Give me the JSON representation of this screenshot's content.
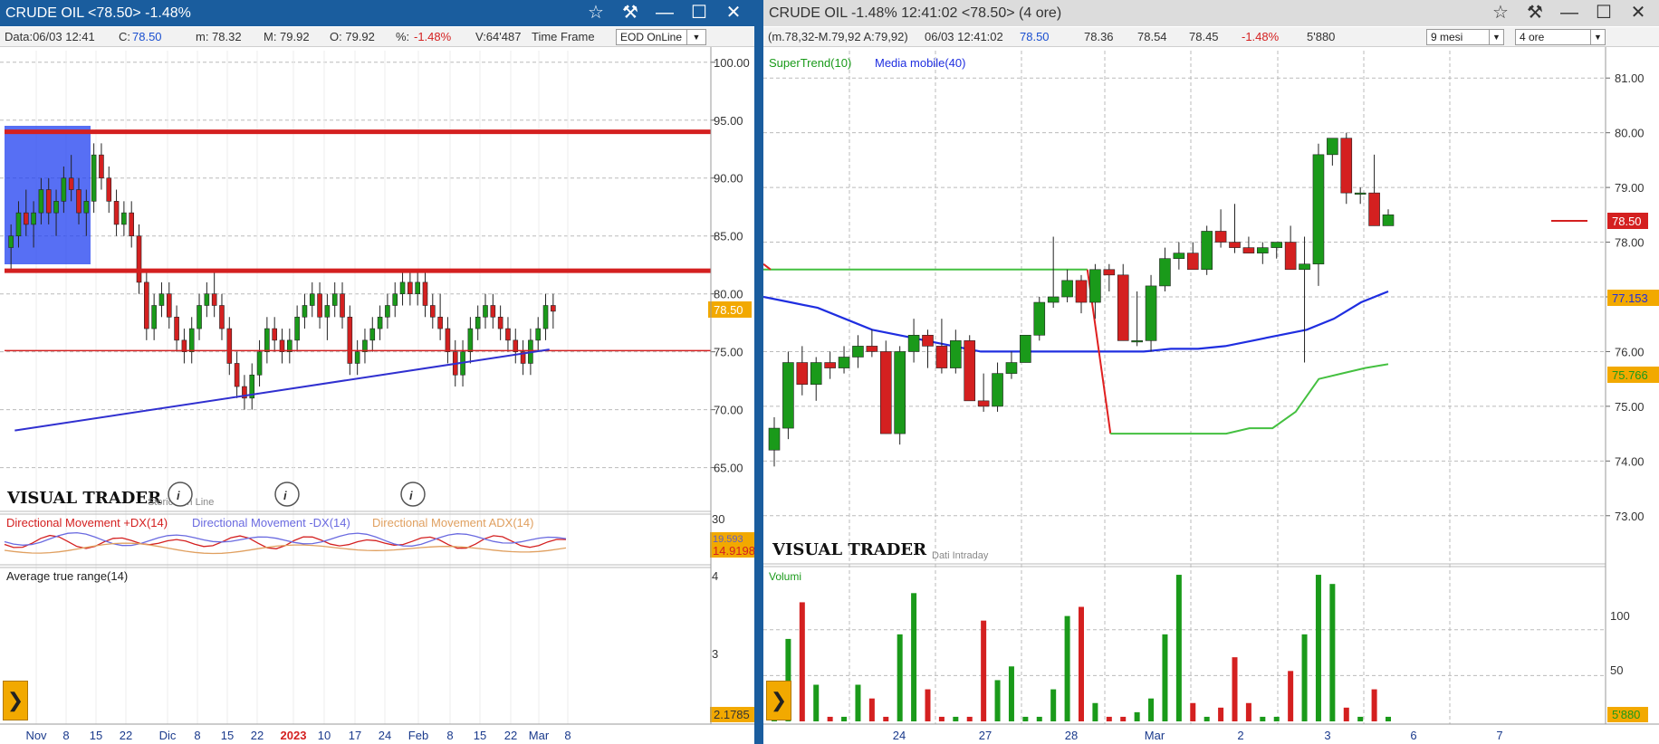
{
  "left": {
    "title": "CRUDE OIL <78.50> -1.48%",
    "info": {
      "data": "Data:06/03 12:41",
      "close_label": "C:",
      "close": "78.50",
      "min": "m: 78.32",
      "max": "M: 79.92",
      "open": "O: 79.92",
      "pct_label": "%:",
      "pct": "-1.48%",
      "vol": "V:64'487",
      "timeframe_label": "Time Frame",
      "timeframe": "EOD OnLine"
    },
    "watermark": "VISUAL TRADER",
    "watermark_sub": "Storico on Line",
    "info_icon": "i",
    "price_axis": [
      "100.00",
      "95.00",
      "90.00",
      "85.00",
      "80.00",
      "75.00",
      "70.00",
      "65.00"
    ],
    "price_badge": "78.50",
    "x_labels": [
      "Nov",
      "8",
      "15",
      "22",
      "Dic",
      "8",
      "15",
      "22",
      "2023",
      "10",
      "17",
      "24",
      "Feb",
      "8",
      "15",
      "22",
      "Mar",
      "8"
    ],
    "dm": {
      "plus_label": "Directional Movement +DX(14)",
      "minus_label": "Directional Movement -DX(14)",
      "adx_label": "Directional Movement ADX(14)",
      "axis_top": "30",
      "badge_minus": "19.593",
      "badge_plus": "14.9198"
    },
    "atr": {
      "label": "Average true range(14)",
      "axis": [
        "4",
        "3"
      ],
      "badge": "2.1785"
    }
  },
  "right": {
    "title": "CRUDE OIL -1.48% 12:41:02 <78.50> (4 ore)",
    "info": {
      "range": "(m.78,32-M.79,92 A:79,92)",
      "datetime": "06/03 12:41:02",
      "last": "78.50",
      "v1": "78.36",
      "v2": "78.54",
      "v3": "78.45",
      "pct": "-1.48%",
      "vol": "5'880",
      "period": "9 mesi",
      "interval": "4 ore"
    },
    "legend": {
      "supertrend": "SuperTrend(10)",
      "ma": "Media mobile(40)"
    },
    "price_axis": [
      "81.00",
      "80.00",
      "79.00",
      "78.00",
      "77.00",
      "76.00",
      "75.00",
      "74.00",
      "73.00"
    ],
    "badges": {
      "last": "78.50",
      "ma": "77.153",
      "st": "75.766"
    },
    "watermark": "VISUAL TRADER",
    "watermark_sub": "Dati Intraday",
    "volume": {
      "label": "Volumi",
      "axis": [
        "100",
        "50"
      ],
      "badge": "5'880"
    },
    "x_labels": [
      "24",
      "27",
      "28",
      "Mar",
      "2",
      "3",
      "6",
      "7"
    ]
  },
  "colors": {
    "up": "#1a9a1a",
    "down": "#d42020",
    "accent": "#1a5d9e",
    "ma": "#1f2ee0",
    "st_green": "#44c040",
    "st_red": "#e02020",
    "badge": "#f2a900"
  },
  "chart_data": [
    {
      "type": "candlestick",
      "title": "CRUDE OIL",
      "x": [
        "Nov",
        "8",
        "15",
        "22",
        "Dic",
        "8",
        "15",
        "22",
        "2023",
        "10",
        "17",
        "24",
        "Feb",
        "8",
        "15",
        "22",
        "Mar",
        "8"
      ],
      "ylim": [
        62,
        101
      ],
      "ohlc": [
        [
          84,
          86,
          82,
          85
        ],
        [
          85,
          88,
          84,
          87
        ],
        [
          87,
          89,
          85,
          86
        ],
        [
          86,
          88,
          84,
          87
        ],
        [
          87,
          90,
          86,
          89
        ],
        [
          89,
          90,
          86,
          87
        ],
        [
          87,
          89,
          85,
          88
        ],
        [
          88,
          91,
          87,
          90
        ],
        [
          90,
          92,
          88,
          89
        ],
        [
          89,
          90,
          86,
          87
        ],
        [
          87,
          89,
          85,
          88
        ],
        [
          88,
          93,
          87,
          92
        ],
        [
          92,
          93,
          89,
          90
        ],
        [
          90,
          91,
          87,
          88
        ],
        [
          88,
          89,
          85,
          86
        ],
        [
          86,
          88,
          85,
          87
        ],
        [
          87,
          88,
          84,
          85
        ],
        [
          85,
          86,
          80,
          81
        ],
        [
          81,
          82,
          76,
          77
        ],
        [
          77,
          80,
          76,
          79
        ],
        [
          79,
          81,
          78,
          80
        ],
        [
          80,
          81,
          77,
          78
        ],
        [
          78,
          79,
          75,
          76
        ],
        [
          76,
          77,
          74,
          75
        ],
        [
          75,
          78,
          74,
          77
        ],
        [
          77,
          80,
          76,
          79
        ],
        [
          79,
          81,
          78,
          80
        ],
        [
          80,
          82,
          78,
          79
        ],
        [
          79,
          80,
          76,
          77
        ],
        [
          77,
          78,
          73,
          74
        ],
        [
          74,
          75,
          71,
          72
        ],
        [
          72,
          73,
          70,
          71
        ],
        [
          71,
          74,
          70,
          73
        ],
        [
          73,
          76,
          72,
          75
        ],
        [
          75,
          78,
          74,
          77
        ],
        [
          77,
          78,
          75,
          76
        ],
        [
          76,
          77,
          74,
          75
        ],
        [
          75,
          77,
          74,
          76
        ],
        [
          76,
          79,
          75,
          78
        ],
        [
          78,
          80,
          77,
          79
        ],
        [
          79,
          81,
          78,
          80
        ],
        [
          80,
          81,
          77,
          78
        ],
        [
          78,
          80,
          76,
          79
        ],
        [
          79,
          81,
          78,
          80
        ],
        [
          80,
          81,
          77,
          78
        ],
        [
          78,
          79,
          73,
          74
        ],
        [
          74,
          76,
          73,
          75
        ],
        [
          75,
          77,
          74,
          76
        ],
        [
          76,
          78,
          75,
          77
        ],
        [
          77,
          79,
          76,
          78
        ],
        [
          78,
          80,
          77,
          79
        ],
        [
          79,
          81,
          78,
          80
        ],
        [
          80,
          82,
          79,
          81
        ],
        [
          81,
          82,
          79,
          80
        ],
        [
          80,
          82,
          79,
          81
        ],
        [
          81,
          82,
          78,
          79
        ],
        [
          79,
          80,
          77,
          78
        ],
        [
          78,
          80,
          76,
          77
        ],
        [
          77,
          78,
          74,
          75
        ],
        [
          75,
          76,
          72,
          73
        ],
        [
          73,
          76,
          72,
          75
        ],
        [
          75,
          78,
          74,
          77
        ],
        [
          77,
          79,
          76,
          78
        ],
        [
          78,
          80,
          77,
          79
        ],
        [
          79,
          80,
          77,
          78
        ],
        [
          78,
          79,
          76,
          77
        ],
        [
          77,
          78,
          75,
          76
        ],
        [
          76,
          77,
          74,
          75
        ],
        [
          75,
          76,
          73,
          74
        ],
        [
          74,
          77,
          73,
          76
        ],
        [
          76,
          78,
          75,
          77
        ],
        [
          77,
          80,
          76,
          79
        ],
        [
          79,
          80,
          77,
          78.5
        ]
      ],
      "hlines": [
        94,
        82,
        75.1
      ],
      "trendline": {
        "from": [
          1,
          68.2
        ],
        "to": [
          72,
          75.2
        ]
      }
    },
    {
      "type": "candlestick",
      "title": "CRUDE OIL (4 ore)",
      "x": [
        "24",
        "27",
        "28",
        "Mar",
        "2",
        "3",
        "6",
        "7"
      ],
      "ylim": [
        72.5,
        81.5
      ],
      "ohlc": [
        [
          74.2,
          74.8,
          73.9,
          74.6
        ],
        [
          74.6,
          76.0,
          74.4,
          75.8
        ],
        [
          75.8,
          76.1,
          75.2,
          75.4
        ],
        [
          75.4,
          75.9,
          75.1,
          75.8
        ],
        [
          75.8,
          76.0,
          75.5,
          75.7
        ],
        [
          75.7,
          76.1,
          75.6,
          75.9
        ],
        [
          75.9,
          76.3,
          75.7,
          76.1
        ],
        [
          76.1,
          76.4,
          75.9,
          76.0
        ],
        [
          76.0,
          76.2,
          74.5,
          74.5
        ],
        [
          74.5,
          76.1,
          74.3,
          76.0
        ],
        [
          76.0,
          76.6,
          75.8,
          76.3
        ],
        [
          76.3,
          76.4,
          75.7,
          76.1
        ],
        [
          76.1,
          76.6,
          75.6,
          75.7
        ],
        [
          75.7,
          76.4,
          75.6,
          76.2
        ],
        [
          76.2,
          76.3,
          75.1,
          75.1
        ],
        [
          75.1,
          75.6,
          74.9,
          75.0
        ],
        [
          75.0,
          75.8,
          74.9,
          75.6
        ],
        [
          75.6,
          76.0,
          75.5,
          75.8
        ],
        [
          75.8,
          76.3,
          75.8,
          76.3
        ],
        [
          76.3,
          77.0,
          76.2,
          76.9
        ],
        [
          76.9,
          78.1,
          76.8,
          77.0
        ],
        [
          77.0,
          77.5,
          76.9,
          77.3
        ],
        [
          77.3,
          77.4,
          76.7,
          76.9
        ],
        [
          76.9,
          77.6,
          76.6,
          77.5
        ],
        [
          77.5,
          77.6,
          77.1,
          77.4
        ],
        [
          77.4,
          77.6,
          76.2,
          76.2
        ],
        [
          76.2,
          77.1,
          76.1,
          76.2
        ],
        [
          76.2,
          77.4,
          76.0,
          77.2
        ],
        [
          77.2,
          77.9,
          77.1,
          77.7
        ],
        [
          77.7,
          78.0,
          77.5,
          77.8
        ],
        [
          77.8,
          78.0,
          77.6,
          77.5
        ],
        [
          77.5,
          78.3,
          77.4,
          78.2
        ],
        [
          78.2,
          78.6,
          77.9,
          78.0
        ],
        [
          78.0,
          78.7,
          77.8,
          77.9
        ],
        [
          77.9,
          78.1,
          77.8,
          77.8
        ],
        [
          77.8,
          78.0,
          77.6,
          77.9
        ],
        [
          77.9,
          78.0,
          77.7,
          78.0
        ],
        [
          78.0,
          78.3,
          77.9,
          77.5
        ],
        [
          77.5,
          78.1,
          75.8,
          77.6
        ],
        [
          77.6,
          79.8,
          77.2,
          79.6
        ],
        [
          79.6,
          79.9,
          79.4,
          79.9
        ],
        [
          79.9,
          80.0,
          78.7,
          78.9
        ],
        [
          78.9,
          79.0,
          78.7,
          78.9
        ],
        [
          78.9,
          79.6,
          78.3,
          78.3
        ],
        [
          78.3,
          78.6,
          78.3,
          78.5
        ]
      ],
      "moving_average_40": [
        77.0,
        76.9,
        76.8,
        76.6,
        76.4,
        76.3,
        76.2,
        76.1,
        76.0,
        76.0,
        76.0,
        76.0,
        76.0,
        76.0,
        76.0,
        76.05,
        76.05,
        76.1,
        76.2,
        76.3,
        76.4,
        76.6,
        76.9,
        77.1
      ],
      "supertrend": [
        77.5,
        77.5,
        77.5,
        77.5,
        77.5,
        77.5,
        77.5,
        77.5,
        77.5,
        77.5,
        77.5,
        77.5,
        77.5,
        77.5,
        77.5,
        74.5,
        74.5,
        74.5,
        74.5,
        74.5,
        74.5,
        74.6,
        74.6,
        74.9,
        75.5,
        75.6,
        75.7,
        75.77
      ],
      "volumes": [
        20,
        90,
        130,
        40,
        5,
        5,
        40,
        25,
        5,
        95,
        140,
        35,
        5,
        5,
        5,
        110,
        45,
        60,
        5,
        5,
        35,
        115,
        125,
        20,
        5,
        5,
        10,
        25,
        95,
        160,
        20,
        5,
        15,
        70,
        20,
        5,
        5,
        55,
        95,
        160,
        150,
        15,
        5,
        35,
        5
      ]
    }
  ]
}
